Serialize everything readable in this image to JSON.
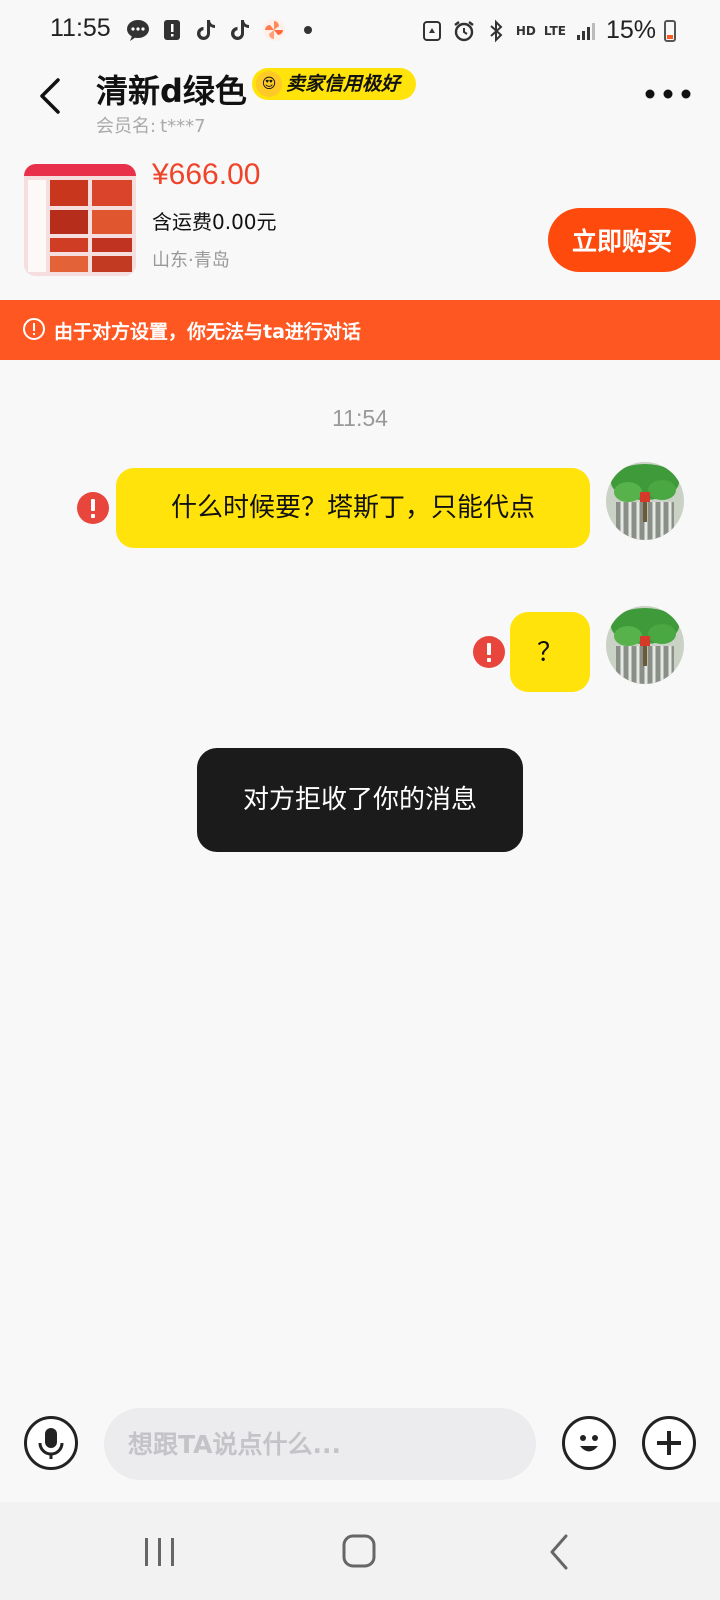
{
  "status_bar": {
    "time": "11:55",
    "battery_percent": "15%",
    "network_hd": "HD",
    "network_lte": "LTE"
  },
  "header": {
    "title": "清新d绿色",
    "badge_text": "卖家信用极好",
    "member_label": "会员名:",
    "member_name": "t***7"
  },
  "product": {
    "price": "¥666.00",
    "shipping": "含运费0.00元",
    "location": "山东·青岛",
    "buy_label": "立即购买"
  },
  "notice": {
    "text": "由于对方设置，你无法与ta进行对话"
  },
  "chat": {
    "timestamp": "11:54",
    "messages": [
      {
        "text": "什么时候要？塔斯丁，只能代点",
        "failed": true
      },
      {
        "text": "？",
        "failed": true
      }
    ],
    "toast": "对方拒收了你的消息"
  },
  "input_bar": {
    "placeholder": "想跟TA说点什么..."
  },
  "colors": {
    "accent_orange": "#ff5722",
    "buy_orange": "#ff4a0e",
    "bubble_yellow": "#ffe30a",
    "price_red": "#f0442a",
    "error_red": "#e8453c"
  }
}
